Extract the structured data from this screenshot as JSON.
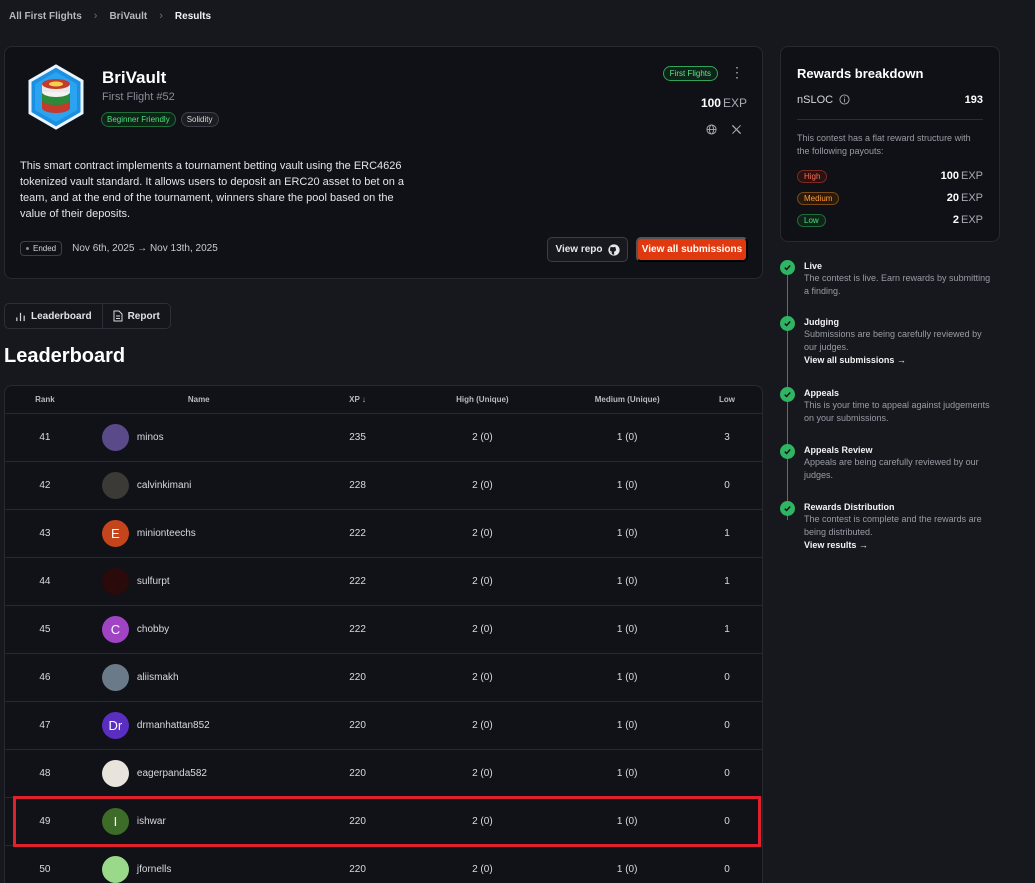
{
  "breadcrumb": {
    "items": [
      "All First Flights",
      "BriVault"
    ],
    "current": "Results"
  },
  "contest": {
    "title": "BriVault",
    "subtitle": "First Flight #52",
    "tags": [
      "Beginner Friendly",
      "Solidity"
    ],
    "badge": "First Flights",
    "exp_value": "100",
    "exp_unit": "EXP",
    "description": "This smart contract implements a tournament betting vault using the ERC4626 tokenized vault standard. It allows users to deposit an ERC20 asset to bet on a team, and at the end of the tournament, winners share the pool based on the value of their deposits.",
    "status": "Ended",
    "dates": "Nov 6th, 2025 → Nov 13th, 2025",
    "view_repo": "View repo",
    "view_submissions": "View all submissions"
  },
  "tabs": [
    "Leaderboard",
    "Report"
  ],
  "leaderboard": {
    "heading": "Leaderboard",
    "columns": {
      "rank": "Rank",
      "name": "Name",
      "xp": "XP ↓",
      "high": "High (Unique)",
      "medium": "Medium (Unique)",
      "low": "Low"
    },
    "rows": [
      {
        "rank": "41",
        "name": "minos",
        "xp": "235",
        "high": "2 (0)",
        "medium": "1 (0)",
        "low": "3",
        "avatar": "minos-pixel",
        "color": "#5a4a8a"
      },
      {
        "rank": "42",
        "name": "calvinkimani",
        "xp": "228",
        "high": "2 (0)",
        "medium": "1 (0)",
        "low": "0",
        "avatar": "photo",
        "color": "#3b3a36"
      },
      {
        "rank": "43",
        "name": "minionteechs",
        "xp": "222",
        "high": "2 (0)",
        "medium": "1 (0)",
        "low": "1",
        "avatar": "E",
        "color": "#c4441c"
      },
      {
        "rank": "44",
        "name": "sulfurpt",
        "xp": "222",
        "high": "2 (0)",
        "medium": "1 (0)",
        "low": "1",
        "avatar": "skull",
        "color": "#2a0a0a"
      },
      {
        "rank": "45",
        "name": "chobby",
        "xp": "222",
        "high": "2 (0)",
        "medium": "1 (0)",
        "low": "1",
        "avatar": "C",
        "color": "#a044c4"
      },
      {
        "rank": "46",
        "name": "aliismakh",
        "xp": "220",
        "high": "2 (0)",
        "medium": "1 (0)",
        "low": "0",
        "avatar": "photo",
        "color": "#6b7a88"
      },
      {
        "rank": "47",
        "name": "drmanhattan852",
        "xp": "220",
        "high": "2 (0)",
        "medium": "1 (0)",
        "low": "0",
        "avatar": "Dr",
        "color": "#5a2ec0"
      },
      {
        "rank": "48",
        "name": "eagerpanda582",
        "xp": "220",
        "high": "2 (0)",
        "medium": "1 (0)",
        "low": "0",
        "avatar": "cartoon",
        "color": "#e8e4dc"
      },
      {
        "rank": "49",
        "name": "ishwar",
        "xp": "220",
        "high": "2 (0)",
        "medium": "1 (0)",
        "low": "0",
        "avatar": "I",
        "color": "#3d6b28"
      },
      {
        "rank": "50",
        "name": "jfornells",
        "xp": "220",
        "high": "2 (0)",
        "medium": "1 (0)",
        "low": "0",
        "avatar": "pattern",
        "color": "#9ad88a"
      }
    ]
  },
  "rewards": {
    "title": "Rewards breakdown",
    "nsloc_label": "nSLOC",
    "nsloc_value": "193",
    "text": "This contest has a flat reward structure with the following payouts:",
    "payouts": [
      {
        "label": "High",
        "value": "100",
        "unit": "EXP"
      },
      {
        "label": "Medium",
        "value": "20",
        "unit": "EXP"
      },
      {
        "label": "Low",
        "value": "2",
        "unit": "EXP"
      }
    ]
  },
  "timeline": [
    {
      "title": "Live",
      "desc": "The contest is live. Earn rewards by submitting a finding.",
      "link": ""
    },
    {
      "title": "Judging",
      "desc": "Submissions are being carefully reviewed by our judges.",
      "link": "View all submissions →"
    },
    {
      "title": "Appeals",
      "desc": "This is your time to appeal against judgements on your submissions.",
      "link": ""
    },
    {
      "title": "Appeals Review",
      "desc": "Appeals are being carefully reviewed by our judges.",
      "link": ""
    },
    {
      "title": "Rewards Distribution",
      "desc": "The contest is complete and the rewards are being distributed.",
      "link": "View results →"
    }
  ]
}
